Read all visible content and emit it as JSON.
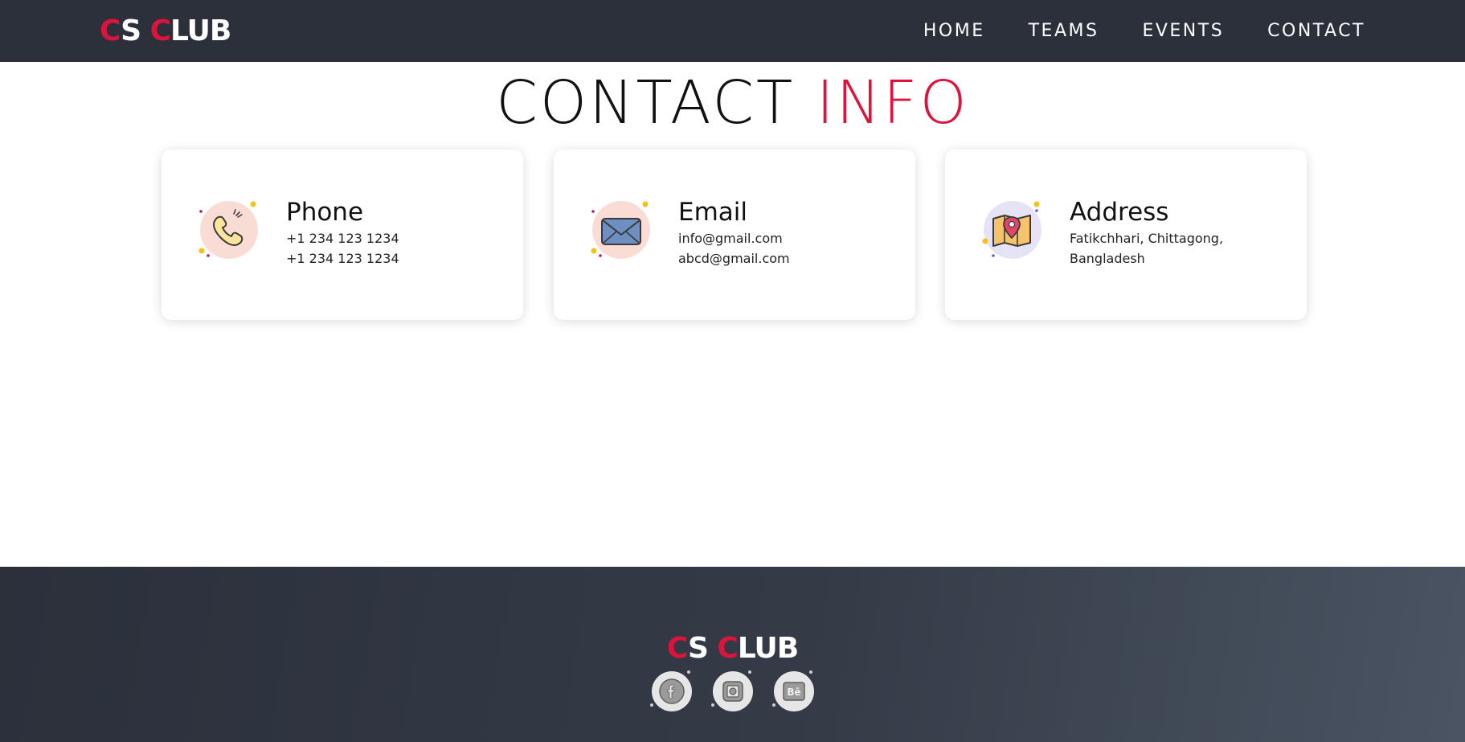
{
  "brand": {
    "part1_accent": "C",
    "part1_rest": "S ",
    "part2_accent": "C",
    "part2_rest": "LUB"
  },
  "nav": {
    "items": [
      {
        "label": "HOME"
      },
      {
        "label": "TEAMS"
      },
      {
        "label": "EVENTS"
      },
      {
        "label": "CONTACT"
      }
    ]
  },
  "section": {
    "title_main": "CONTACT ",
    "title_accent": "INFO"
  },
  "cards": [
    {
      "icon": "phone-icon",
      "title": "Phone",
      "lines": [
        "+1 234 123 1234",
        "+1 234 123 1234"
      ]
    },
    {
      "icon": "email-icon",
      "title": "Email",
      "lines": [
        "info@gmail.com",
        "abcd@gmail.com"
      ]
    },
    {
      "icon": "map-pin-icon",
      "title": "Address",
      "lines": [
        "Fatikchhari, Chittagong,",
        "Bangladesh"
      ]
    }
  ],
  "footer": {
    "socials": [
      {
        "icon": "facebook-icon"
      },
      {
        "icon": "instagram-icon"
      },
      {
        "icon": "behance-icon",
        "text": "Bē"
      }
    ]
  },
  "colors": {
    "accent": "#dc143c",
    "navbar": "#2b303b",
    "footer_start": "#2b303b",
    "footer_end": "#4a5462"
  }
}
